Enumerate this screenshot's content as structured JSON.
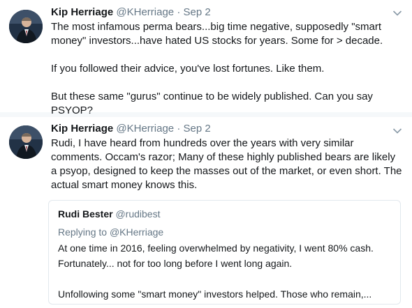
{
  "tweets": [
    {
      "author_name": "Kip Herriage",
      "author_handle": "@KHerriage",
      "separator": "·",
      "date": "Sep 2",
      "avatar_icon": "user-avatar-icon",
      "menu_icon": "chevron-down-icon",
      "paragraphs": [
        "The most infamous perma bears...big time negative, supposedly \"smart money\" investors...have hated US stocks for years. Some for > decade.",
        "If you followed their advice, you've lost fortunes. Like them.",
        "But these same \"gurus\" continue to be widely published. Can you say PSYOP?"
      ]
    },
    {
      "author_name": "Kip Herriage",
      "author_handle": "@KHerriage",
      "separator": "·",
      "date": "Sep 2",
      "avatar_icon": "user-avatar-icon",
      "menu_icon": "chevron-down-icon",
      "paragraphs": [
        "Rudi, I have heard from hundreds over the years with very similar comments. Occam's razor; Many of these highly published bears are likely a psyop, designed to keep the masses out of the market, or even short. The actual smart money knows this."
      ],
      "quoted": {
        "author_name": "Rudi Bester",
        "author_handle": "@rudibest",
        "replying_prefix": "Replying to",
        "replying_to": "@KHerriage",
        "paragraphs": [
          "At one time in 2016, feeling overwhelmed by negativity, I went 80% cash. Fortunately... not for too long before I went long again.",
          "Unfollowing some \"smart money\" investors helped. Those who remain,..."
        ]
      }
    }
  ],
  "colors": {
    "text": "#14171a",
    "secondary": "#657786",
    "border": "#e1e8ed",
    "page_background": "#f5f8fa"
  }
}
